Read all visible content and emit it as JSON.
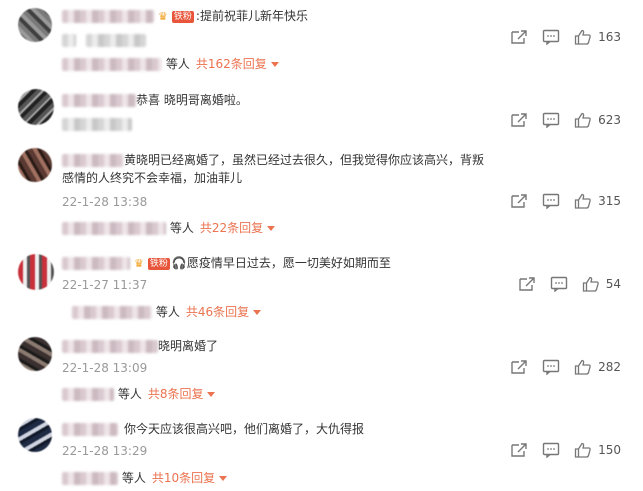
{
  "badge_label": "铁粉",
  "comments": [
    {
      "text": "提前祝菲儿新年快乐",
      "has_badge": true,
      "timestamp": "",
      "likes": "163",
      "replies_prefix": "等人",
      "replies_link": "共162条回复"
    },
    {
      "text": "恭喜 晓明哥离婚啦。",
      "has_badge": false,
      "timestamp": "",
      "likes": "623",
      "replies_prefix": "",
      "replies_link": ""
    },
    {
      "text": "黄晓明已经离婚了，虽然已经过去很久，但我觉得你应该高兴，背叛感情的人终究不会幸福，加油菲儿",
      "has_badge": false,
      "timestamp": "22-1-28 13:38",
      "likes": "315",
      "replies_prefix": "等人",
      "replies_link": "共22条回复"
    },
    {
      "text": "愿疫情早日过去，愿一切美好如期而至",
      "has_badge": true,
      "timestamp": "22-1-27 11:37",
      "likes": "54",
      "replies_prefix": "等人",
      "replies_link": "共46条回复"
    },
    {
      "text": "晓明离婚了",
      "has_badge": false,
      "timestamp": "22-1-28 13:09",
      "likes": "282",
      "replies_prefix": "等人",
      "replies_link": "共8条回复"
    },
    {
      "text": "你今天应该很高兴吧，他们离婚了，大仇得报",
      "has_badge": false,
      "timestamp": "22-1-28 13:29",
      "likes": "150",
      "replies_prefix": "等人",
      "replies_link": "共10条回复"
    }
  ]
}
